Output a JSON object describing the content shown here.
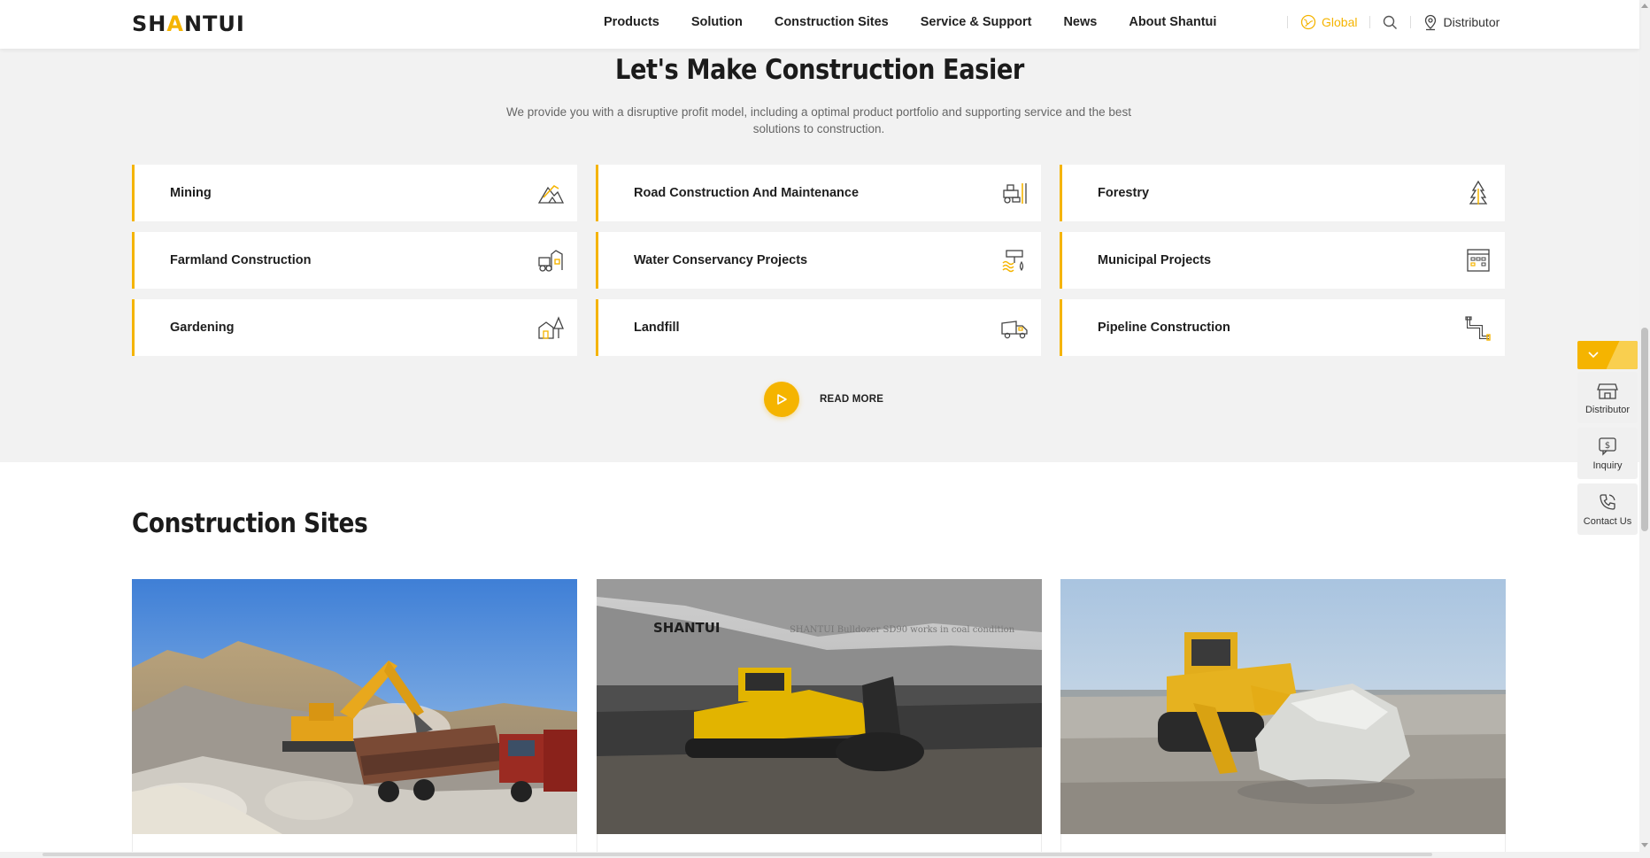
{
  "header": {
    "logo_pre": "SH",
    "logo_a": "A",
    "logo_post": "NTUI",
    "nav": [
      "Products",
      "Solution",
      "Construction Sites",
      "Service & Support",
      "News",
      "About Shantui"
    ],
    "global_label": "Global",
    "distributor_label": "Distributor"
  },
  "solutions": {
    "title": "Let's Make Construction Easier",
    "description": "We provide you with a disruptive profit model, including a optimal product portfolio and supporting service and the best solutions to construction.",
    "items": [
      {
        "label": "Mining",
        "icon": "mining-icon"
      },
      {
        "label": "Road Construction And Maintenance",
        "icon": "road-roller-icon"
      },
      {
        "label": "Forestry",
        "icon": "tree-icon"
      },
      {
        "label": "Farmland Construction",
        "icon": "tractor-icon"
      },
      {
        "label": "Water Conservancy Projects",
        "icon": "water-icon"
      },
      {
        "label": "Municipal Projects",
        "icon": "building-icon"
      },
      {
        "label": "Gardening",
        "icon": "house-tree-icon"
      },
      {
        "label": "Landfill",
        "icon": "truck-icon"
      },
      {
        "label": "Pipeline Construction",
        "icon": "pipe-icon"
      }
    ],
    "read_more": "READ MORE"
  },
  "sites": {
    "title": "Construction Sites",
    "photo2_brand": "SHANTUI",
    "photo2_caption": "SHANTUI Bulldozer SD90 works in coal condition"
  },
  "float_bar": {
    "items": [
      "Distributor",
      "Inquiry",
      "Contact Us"
    ]
  },
  "colors": {
    "accent": "#f5b400",
    "section_bg": "#f2f2f2"
  }
}
